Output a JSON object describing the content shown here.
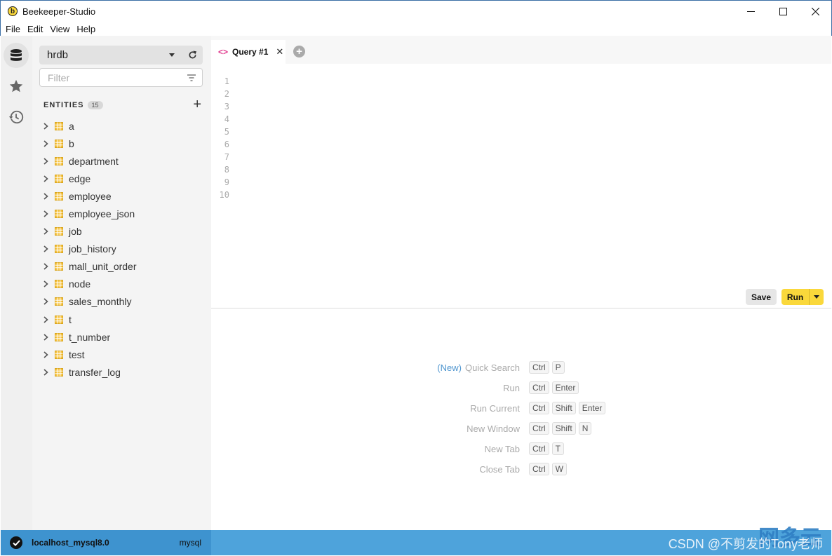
{
  "window": {
    "title": "Beekeeper-Studio",
    "logo_letter": "b"
  },
  "menu": [
    "File",
    "Edit",
    "View",
    "Help"
  ],
  "rail": [
    {
      "icon": "database-icon",
      "active": true
    },
    {
      "icon": "star-icon",
      "active": false
    },
    {
      "icon": "history-icon",
      "active": false
    }
  ],
  "sidebar": {
    "database": "hrdb",
    "filter_placeholder": "Filter",
    "entities_label": "ENTITIES",
    "entities_count": "15",
    "entities": [
      "a",
      "b",
      "department",
      "edge",
      "employee",
      "employee_json",
      "job",
      "job_history",
      "mall_unit_order",
      "node",
      "sales_monthly",
      "t",
      "t_number",
      "test",
      "transfer_log"
    ]
  },
  "tabs": [
    {
      "label": "Query #1",
      "icon": "code-icon"
    }
  ],
  "editor": {
    "line_numbers": [
      "1",
      "2",
      "3",
      "4",
      "5",
      "6",
      "7",
      "8",
      "9",
      "10"
    ],
    "save_label": "Save",
    "run_label": "Run"
  },
  "shortcuts": [
    {
      "tag": "(New)",
      "label": "Quick Search",
      "keys": [
        "Ctrl",
        "P"
      ]
    },
    {
      "tag": "",
      "label": "Run",
      "keys": [
        "Ctrl",
        "Enter"
      ]
    },
    {
      "tag": "",
      "label": "Run Current",
      "keys": [
        "Ctrl",
        "Shift",
        "Enter"
      ]
    },
    {
      "tag": "",
      "label": "New Window",
      "keys": [
        "Ctrl",
        "Shift",
        "N"
      ]
    },
    {
      "tag": "",
      "label": "New Tab",
      "keys": [
        "Ctrl",
        "T"
      ]
    },
    {
      "tag": "",
      "label": "Close Tab",
      "keys": [
        "Ctrl",
        "W"
      ]
    }
  ],
  "status": {
    "connection": "localhost_mysql8.0",
    "type": "mysql",
    "watermark": "CSDN @不剪发的Tony老师",
    "watermark_logo": "网多云"
  },
  "colors": {
    "accent": "#fad83b",
    "statusbar": "#4ea3db",
    "tag": "#4e95cf"
  }
}
